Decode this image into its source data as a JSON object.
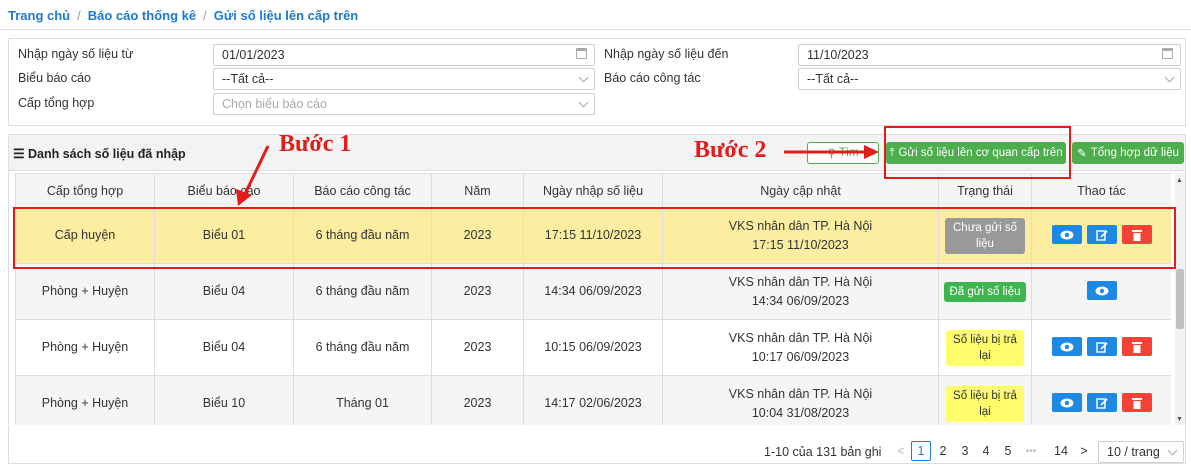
{
  "breadcrumb": [
    "Trang chủ",
    "Báo cáo thống kê",
    "Gửi số liệu lên cấp trên"
  ],
  "filters": {
    "date_from_label": "Nhập ngày số liệu từ",
    "date_from_value": "01/01/2023",
    "date_to_label": "Nhập ngày số liệu đến",
    "date_to_value": "11/10/2023",
    "report_form_label": "Biểu báo cáo",
    "report_form_value": "--Tất cả--",
    "work_report_label": "Báo cáo công tác",
    "work_report_value": "--Tất cả--",
    "level_label": "Cấp tổng hợp",
    "level_placeholder": "Chọn biểu báo cáo"
  },
  "panel": {
    "title": "Danh sách số liệu đã nhập",
    "search_button": "Tìm",
    "send_button": "Gửi số liệu lên cơ quan cấp trên",
    "aggregate_button": "Tổng hợp dữ liệu"
  },
  "table": {
    "columns": [
      "Cấp tổng hợp",
      "Biểu báo cáo",
      "Báo cáo công tác",
      "Năm",
      "Ngày nhập số liệu",
      "Ngày cập nhật",
      "Trạng thái",
      "Thao tác"
    ],
    "rows": [
      {
        "level": "Cấp huyện",
        "form": "Biểu 01",
        "work": "6 tháng đầu năm",
        "year": "2023",
        "entered": "17:15 11/10/2023",
        "updated_by": "VKS nhân dân TP. Hà Nội",
        "updated_at": "17:15 11/10/2023",
        "status": "Chưa gửi số liệu"
      },
      {
        "level": "Phòng + Huyện",
        "form": "Biểu 04",
        "work": "6 tháng đầu năm",
        "year": "2023",
        "entered": "14:34 06/09/2023",
        "updated_by": "VKS nhân dân TP. Hà Nội",
        "updated_at": "14:34 06/09/2023",
        "status": "Đã gửi số liệu"
      },
      {
        "level": "Phòng + Huyện",
        "form": "Biểu 04",
        "work": "6 tháng đầu năm",
        "year": "2023",
        "entered": "10:15 06/09/2023",
        "updated_by": "VKS nhân dân TP. Hà Nội",
        "updated_at": "10:17 06/09/2023",
        "status": "Số liệu bị trả lại"
      },
      {
        "level": "Phòng + Huyện",
        "form": "Biểu 10",
        "work": "Tháng 01",
        "year": "2023",
        "entered": "14:17 02/06/2023",
        "updated_by": "VKS nhân dân TP. Hà Nội",
        "updated_at": "10:04 31/08/2023",
        "status": "Số liệu bị trả lại"
      }
    ]
  },
  "pagination": {
    "summary": "1-10 của 131 bản ghi",
    "pages": [
      "1",
      "2",
      "3",
      "4",
      "5"
    ],
    "ellipsis": "•••",
    "last_page": "14",
    "current_page": "1",
    "page_size": "10 / trang"
  },
  "annotations": {
    "step1": "Bước 1",
    "step2": "Bước 2"
  },
  "colors": {
    "accent": "#1a7bd0",
    "green": "#4cae4c",
    "highlight": "#fbeea0",
    "annotation": "#e31b1b"
  }
}
